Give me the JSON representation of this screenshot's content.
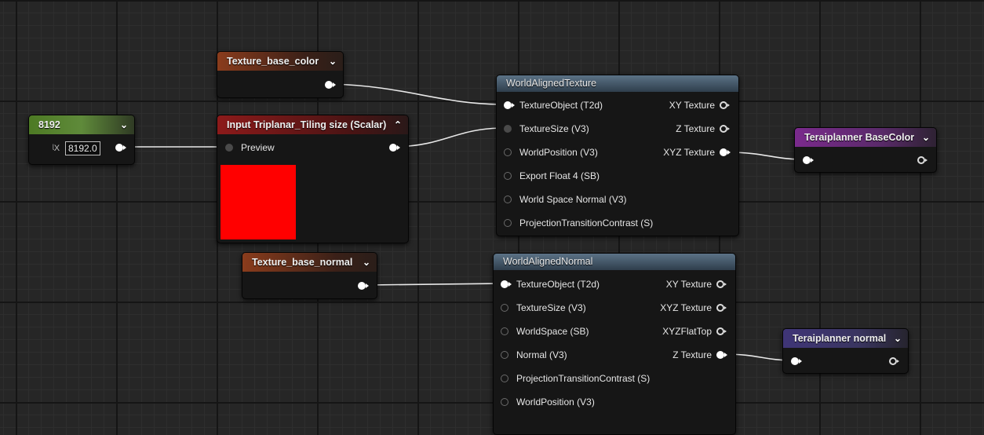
{
  "nodes": {
    "const_8192": {
      "title": "8192",
      "input_prefix": "ᶩX",
      "value": "8192.0"
    },
    "texture_base_color": {
      "title": "Texture_base_color"
    },
    "input_triplanar": {
      "title": "Input Triplanar_Tiling size (Scalar)",
      "preview_label": "Preview",
      "preview_color": "#ff0000"
    },
    "world_aligned_texture": {
      "title": "WorldAlignedTexture",
      "inputs": [
        "TextureObject (T2d)",
        "TextureSize (V3)",
        "WorldPosition (V3)",
        "Export Float 4 (SB)",
        "World Space Normal (V3)",
        "ProjectionTransitionContrast (S)"
      ],
      "outputs": [
        "XY Texture",
        "Z Texture",
        "XYZ Texture"
      ]
    },
    "terai_basecolor": {
      "title": "Teraiplanner BaseColor"
    },
    "texture_base_normal": {
      "title": "Texture_base_normal"
    },
    "world_aligned_normal": {
      "title": "WorldAlignedNormal",
      "inputs": [
        "TextureObject (T2d)",
        "TextureSize (V3)",
        "WorldSpace (SB)",
        "Normal (V3)",
        "ProjectionTransitionContrast (S)",
        "WorldPosition (V3)"
      ],
      "outputs": [
        "XY Texture",
        "XYZ Texture",
        "XYZFlatTop",
        "Z Texture"
      ]
    },
    "terai_normal": {
      "title": "Teraiplanner normal"
    }
  },
  "icons": {
    "collapse": "chevron-down-icon",
    "expand": "chevron-up-icon"
  },
  "colors": {
    "graph_background": "#262626",
    "wire": "#e8e8e8",
    "preview_swatch": "#ff0000"
  }
}
